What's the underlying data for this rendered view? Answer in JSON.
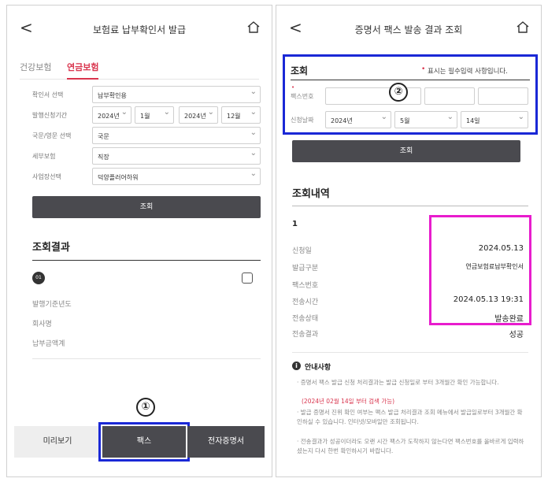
{
  "left": {
    "header": {
      "back": "<",
      "title": "보험료 납부확인서 발급"
    },
    "tabs": [
      {
        "label": "건강보험"
      },
      {
        "label": "연금보험"
      }
    ],
    "form": {
      "purpose": {
        "label": "확인서 선택",
        "value": "납부확인용"
      },
      "period": {
        "label": "발행신청기간",
        "start_year": "2024년",
        "start_month": "1월",
        "end_year": "2024년",
        "end_month": "12월"
      },
      "language": {
        "label": "국문/영문 선택",
        "value": "국문"
      },
      "insured_type": {
        "label": "세부보험",
        "value": "직장"
      },
      "workplace": {
        "label": "사업장선택",
        "value": "덕양플러어하워"
      }
    },
    "search_button": "조회",
    "results": {
      "title": "조회결과",
      "item_index": "01",
      "fields": [
        "발행기준년도",
        "회사명",
        "납부금액계"
      ]
    },
    "bottom_bar": {
      "preview": "미리보기",
      "fax": "팩스",
      "e_cert": "전자증명서"
    },
    "callout": "①"
  },
  "right": {
    "header": {
      "back": "<",
      "title": "증명서 팩스 발송 결과 조회"
    },
    "search_form": {
      "title": "조회",
      "required_note": "표시는 필수입력 사항입니다.",
      "required_mark": "•",
      "fax_label": "팩스번호",
      "date_label": "신청날짜",
      "year": "2024년",
      "month": "5월",
      "day": "14일"
    },
    "search_button": "조회",
    "history": {
      "title": "조회내역",
      "index": "1",
      "rows": [
        {
          "label": "신청일",
          "value": "2024.05.13"
        },
        {
          "label": "발급구분",
          "value": "연금보험료납부확인서"
        },
        {
          "label": "팩스번호",
          "value": ""
        },
        {
          "label": "전송시간",
          "value": "2024.05.13 19:31"
        },
        {
          "label": "전송상태",
          "value": "발송완료"
        },
        {
          "label": "전송결과",
          "value": "성공"
        }
      ]
    },
    "notice": {
      "title": "안내사항",
      "items": [
        "증명서 팩스 발급 신청 처리결과는 발급 신청일로 부터 3개월간 확인 가능합니다.",
        "(2024년 02월 14일 부터 검색 가능)",
        "발급 증명서 진위 확인 여부는 팩스 발급 처리결과 조회 메뉴에서 발급일로부터 3개월간 확인하실 수 있습니다. 인터넷/모바일만 조회됩니다.",
        "전송결과가 성공이더라도 오랜 시간 팩스가 도착하지 않는다면 팩스번호를 올바르게 입력하셨는지 다시 한번 확인하시기 바랍니다."
      ]
    },
    "callout": "②"
  },
  "colors": {
    "accent_red": "#d9344d",
    "button_dark": "#4a4a4f",
    "highlight_blue": "#1a28d6",
    "highlight_pink": "#e81ccd"
  }
}
